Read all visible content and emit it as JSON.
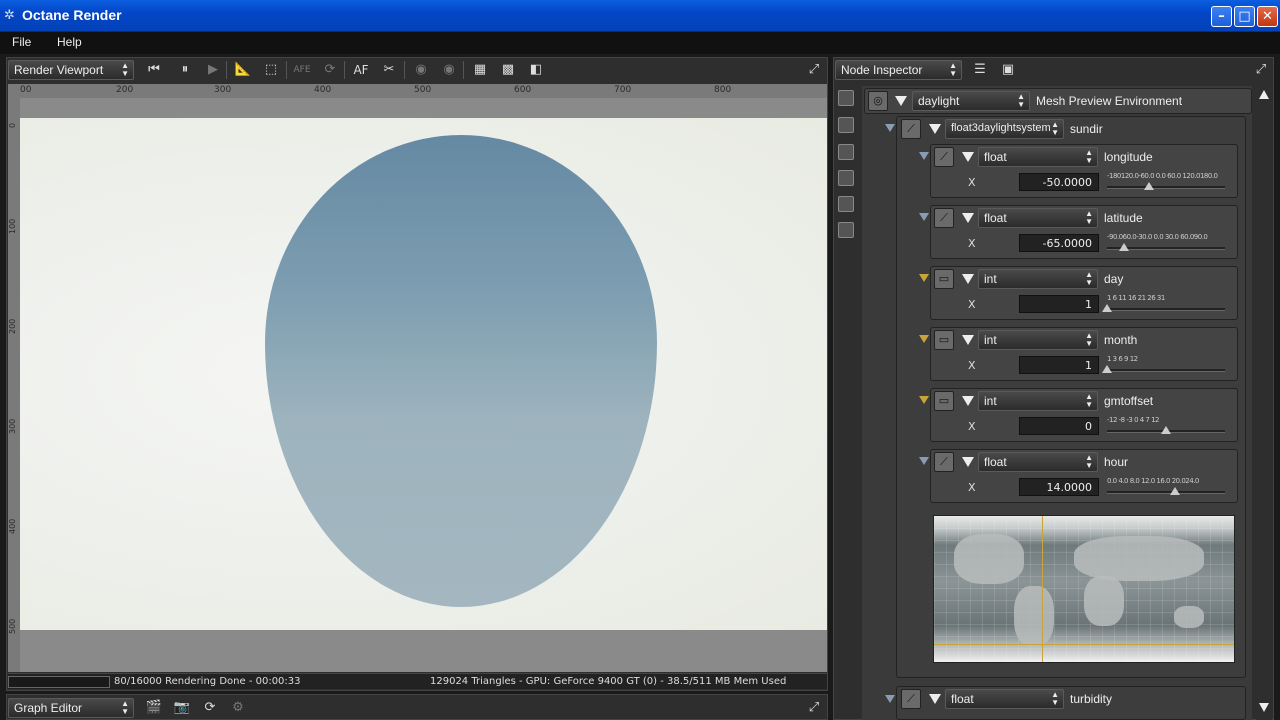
{
  "window": {
    "title": "Octane Render",
    "minimize": "–",
    "maximize": "□",
    "close": "✕"
  },
  "menu": {
    "items": [
      "File",
      "Help"
    ]
  },
  "viewport_panel": {
    "selector": "Render Viewport",
    "toolbar_icons": [
      "rewind-icon",
      "pause-icon",
      "play-icon",
      "ruler-icon",
      "region-icon",
      "af-disabled-icon",
      "refresh-icon",
      "af-icon",
      "pick-icon",
      "sphere-icon",
      "sphere2-icon",
      "grid-icon",
      "checker-icon",
      "half-icon",
      "maximize-icon"
    ],
    "af_label": "AF",
    "afe_label": "AFE",
    "ruler_top": [
      "00",
      "200",
      "300",
      "400",
      "500",
      "600",
      "700",
      "800"
    ],
    "ruler_left": [
      "0",
      "100",
      "200",
      "300",
      "400",
      "500"
    ],
    "status_progress": "80/16000 Rendering Done - 00:00:33",
    "status_info": "129024 Triangles - GPU: GeForce 9400 GT (0) - 38.5/511 MB Mem Used"
  },
  "graph_editor": {
    "selector": "Graph Editor"
  },
  "node_inspector": {
    "selector": "Node Inspector",
    "root": {
      "type": "daylight",
      "name": "Mesh Preview Environment"
    },
    "sundir": {
      "type": "float3daylightsystem",
      "name": "sundir"
    },
    "params": [
      {
        "type": "float",
        "name": "longitude",
        "axis": "X",
        "value": "-50.0000",
        "ticks": "-180120.0-60.0  0.0  60.0 120.0180.0",
        "thumb": 0.36
      },
      {
        "type": "float",
        "name": "latitude",
        "axis": "X",
        "value": "-65.0000",
        "ticks": "-90.060.0-30.0  0.0  30.0  60.090.0",
        "thumb": 0.14
      },
      {
        "type": "int",
        "name": "day",
        "axis": "X",
        "value": "1",
        "ticks": "1    6    11   16   21   26  31",
        "thumb": 0.0
      },
      {
        "type": "int",
        "name": "month",
        "axis": "X",
        "value": "1",
        "ticks": "1        3        6        9     12",
        "thumb": 0.0
      },
      {
        "type": "int",
        "name": "gmtoffset",
        "axis": "X",
        "value": "0",
        "ticks": "-12 -8   -3    0    4    7   12",
        "thumb": 0.5
      },
      {
        "type": "float",
        "name": "hour",
        "axis": "X",
        "value": "14.0000",
        "ticks": "0.0 4.0  8.0 12.0 16.0 20.024.0",
        "thumb": 0.58
      }
    ],
    "turbidity": {
      "type": "float",
      "name": "turbidity"
    }
  },
  "colors": {
    "accent": "#c8a43a",
    "titlebar": "#0446c8",
    "panel": "#2e2e2e"
  }
}
